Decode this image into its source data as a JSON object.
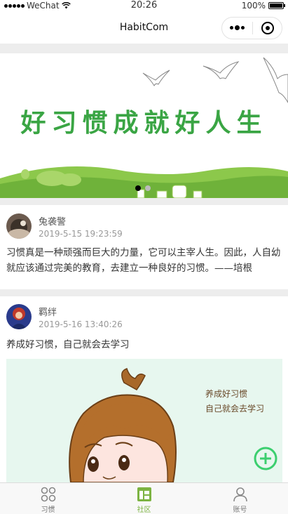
{
  "status_bar": {
    "carrier": "WeChat",
    "time": "20:26",
    "battery": "100%"
  },
  "nav": {
    "title": "HabitCom"
  },
  "banner": {
    "slogan": "好习惯成就好人生",
    "slide_count": 2,
    "active_slide": 0
  },
  "posts": [
    {
      "author": "兔袭警",
      "time": "2019-5-15 19:23:59",
      "content": "习惯真是一种顽强而巨大的力量，它可以主宰人生。因此，人自幼就应该通过完美的教育，去建立一种良好的习惯。——培根"
    },
    {
      "author": "羁绊",
      "time": "2019-5-16 13:40:26",
      "content": "养成好习惯，自己就会去学习",
      "image_caption": [
        "养成好习惯",
        "自己就会去学习"
      ]
    }
  ],
  "tabs": [
    {
      "label": "习惯",
      "icon": "habit-grid-icon",
      "active": false
    },
    {
      "label": "社区",
      "icon": "community-icon",
      "active": true
    },
    {
      "label": "账号",
      "icon": "account-icon",
      "active": false
    }
  ],
  "colors": {
    "accent_green": "#7cb342",
    "slogan_green": "#3aa544",
    "fab_green": "#3ccf6f"
  }
}
